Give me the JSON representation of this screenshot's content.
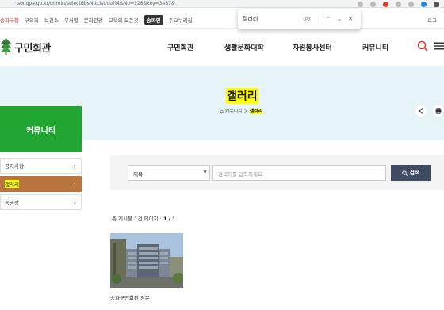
{
  "browser": {
    "url": "songpa.go.kr/gumin/selectBbsNttList.do?bbsNo=128&key=3487&"
  },
  "findbar": {
    "query": "갤러리",
    "count": "0/3",
    "up": "⌃",
    "down": "⌄",
    "close": "✕"
  },
  "utility": {
    "items": [
      "송파구청",
      "구의회",
      "보건소",
      "부서별",
      "문화관광",
      "교육의 모든것"
    ],
    "tag": "송파인",
    "more": "주요누리집",
    "login": "로그"
  },
  "header": {
    "logo": "구민회관",
    "nav": [
      "구민회관",
      "생활문화대학",
      "자원봉사센터",
      "커뮤니티"
    ]
  },
  "hero": {
    "title": "갤러리",
    "home": "⌂",
    "crumb_parent": "커뮤니티",
    "crumb_sep": ">",
    "crumb_current": "갤러리"
  },
  "side": {
    "title": "커뮤니티",
    "items": [
      {
        "label": "공지사항",
        "active": false
      },
      {
        "label": "갤러리",
        "active": true
      },
      {
        "label": "동영상",
        "active": false
      }
    ]
  },
  "search": {
    "select_value": "제목",
    "placeholder": "검색어를 입력하세요",
    "button": "검색"
  },
  "list": {
    "total_prefix": "총 게시물",
    "total_count": "1",
    "total_unit": "건",
    "page_prefix": "페이지 :",
    "page_current": "1",
    "page_sep": "/",
    "page_total": "1"
  },
  "gallery": [
    {
      "caption": "송파구민회관 정문"
    }
  ],
  "colors": {
    "accent_green": "#21a634",
    "active_brown": "#b8753e",
    "hero_bg": "#e6f4f7",
    "search_btn": "#3f4a63",
    "highlight": "#ffff00"
  }
}
